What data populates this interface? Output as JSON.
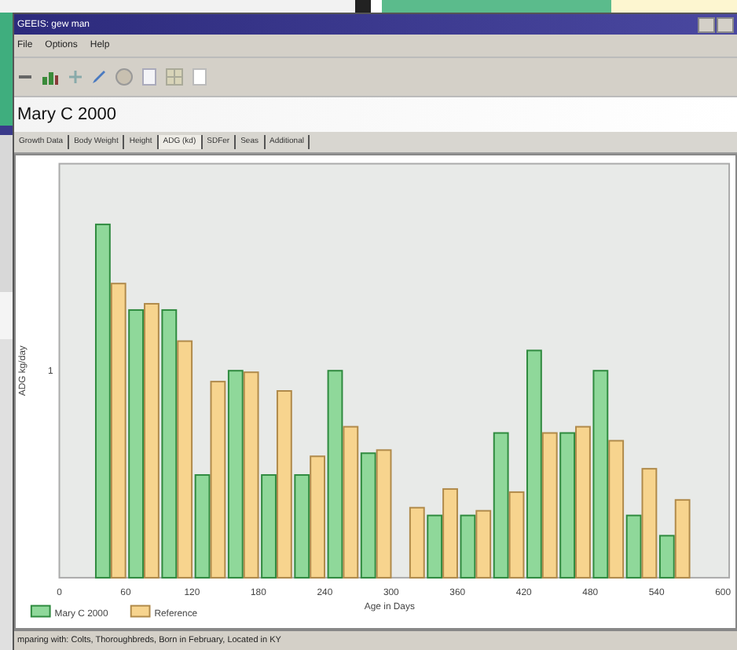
{
  "window": {
    "title": "GEEIS: gew man"
  },
  "menu": [
    "File",
    "Options",
    "Help"
  ],
  "header": "Mary C 2000",
  "tabs": [
    {
      "label": "Growth Data",
      "selected": false
    },
    {
      "label": "Body Weight",
      "selected": false
    },
    {
      "label": "Height",
      "selected": false
    },
    {
      "label": "ADG (kd)",
      "selected": true
    },
    {
      "label": "SDFer",
      "selected": false
    },
    {
      "label": "Seas",
      "selected": false
    },
    {
      "label": "Additional",
      "selected": false
    }
  ],
  "chart": {
    "ylabel": "ADG kg/day",
    "yticks": [
      "1"
    ],
    "xticks": [
      "0",
      "60",
      "120",
      "180",
      "240",
      "300",
      "360",
      "420",
      "480",
      "540",
      "600"
    ],
    "xlabel": "Age in Days",
    "legend": [
      "Mary C 2000",
      "Reference"
    ]
  },
  "status_bar": "mparing with: Colts, Thoroughbreds, Born in February, Located in KY"
}
